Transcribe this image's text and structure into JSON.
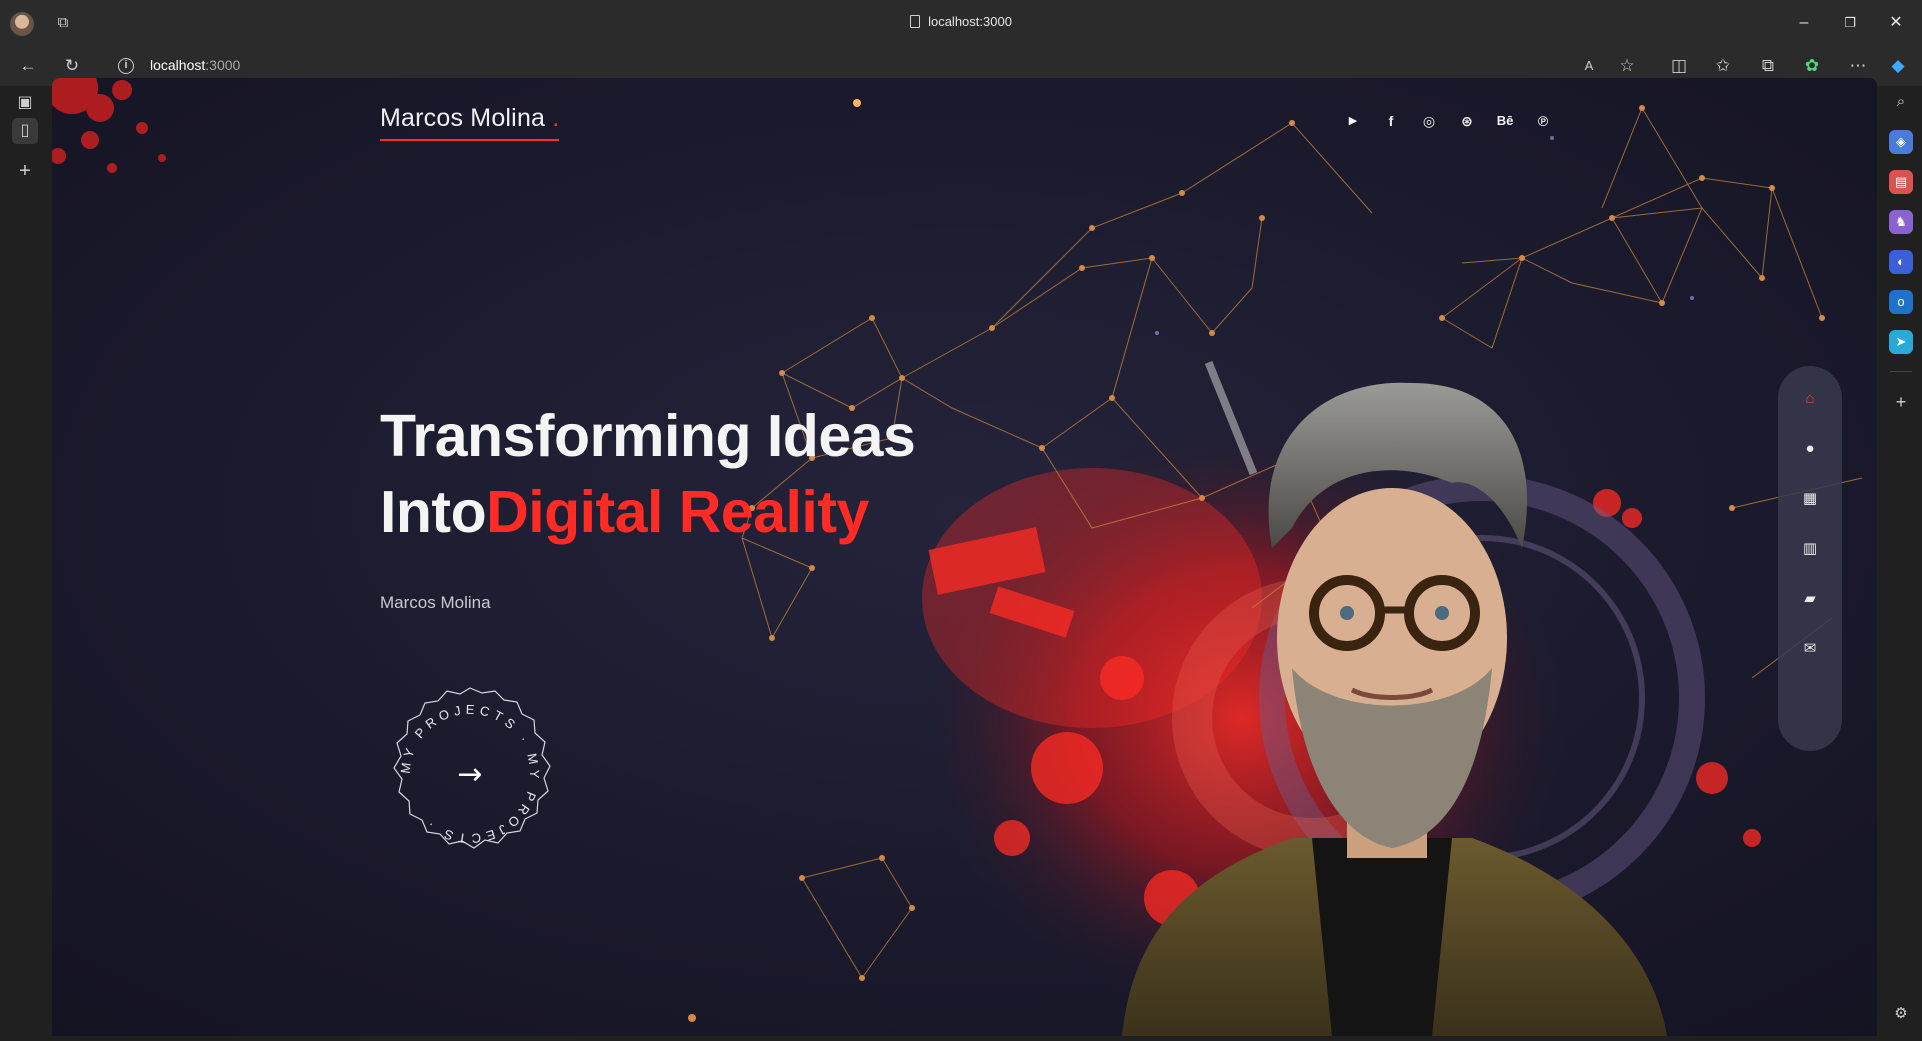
{
  "browser": {
    "tab_title": "localhost:3000",
    "url_host": "localhost",
    "url_port": ":3000",
    "window_controls": {
      "minimize": "–",
      "restore": "❐",
      "close": "✕"
    }
  },
  "site": {
    "brand_name": "Marcos Molina",
    "brand_dot": ".",
    "socials": [
      "youtube-icon",
      "facebook-icon",
      "instagram-icon",
      "dribbble-icon",
      "behance-icon",
      "pinterest-icon"
    ],
    "social_glyphs": {
      "youtube": "▶",
      "facebook": "f",
      "instagram": "◎",
      "dribbble": "⊛",
      "behance": "Bē",
      "pinterest": "℗"
    },
    "hero": {
      "line1": "Transforming Ideas",
      "line2_plain": "Into",
      "line2_accent": "Digital Reality",
      "subtitle": "Marcos Molina"
    },
    "badge": {
      "text": "MY PROJECTS · MY PROJECTS ·",
      "arrow": "→"
    },
    "side_nav": [
      "home-icon",
      "user-icon",
      "services-icon",
      "portfolio-icon",
      "testimonial-icon",
      "mail-icon"
    ],
    "colors": {
      "accent": "#ff2b24",
      "background": "#1d1c2e",
      "nav_bg": "#3a3a4e"
    }
  }
}
